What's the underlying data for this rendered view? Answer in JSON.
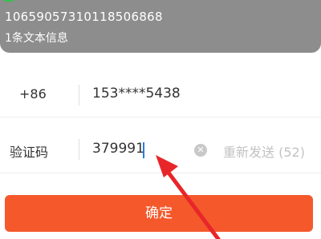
{
  "notification": {
    "sender": "10659057310118506868",
    "preview": "1条文本信息"
  },
  "form": {
    "country_code": "+86",
    "phone": "153****5438",
    "code_label": "验证码",
    "code_value": "379991",
    "resend_label": "重新发送 (52)",
    "confirm_label": "确定"
  },
  "colors": {
    "accent": "#f4582b",
    "notification_bg": "#8d8d8d",
    "arrow": "#e8262a"
  }
}
